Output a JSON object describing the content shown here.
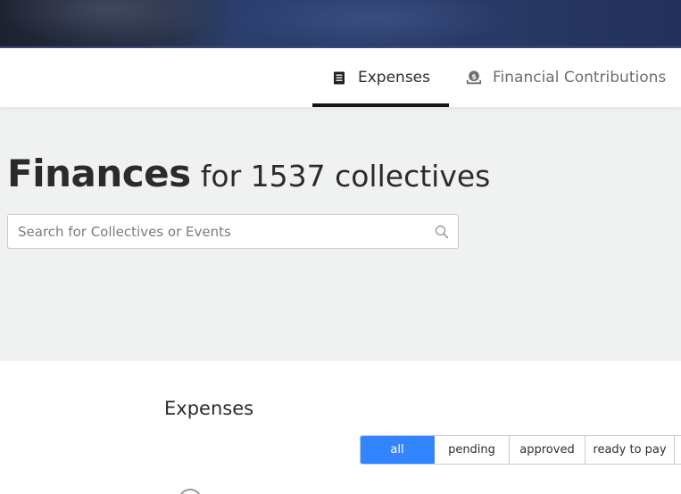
{
  "tabs": {
    "expenses": {
      "label": "Expenses",
      "icon": "receipt-icon",
      "active": true
    },
    "contributions": {
      "label": "Financial Contributions",
      "icon": "money-upload-icon",
      "active": false
    }
  },
  "hero": {
    "title_strong": "Finances",
    "title_rest": "for 1537 collectives",
    "search": {
      "placeholder": "Search for Collectives or Events",
      "value": "",
      "icon": "search-icon"
    }
  },
  "expenses": {
    "heading": "Expenses",
    "filters": [
      "all",
      "pending",
      "approved",
      "ready to pay"
    ],
    "active_filter": "all"
  },
  "colors": {
    "accent": "#3385ff",
    "banner": "#2c3f6f",
    "hero_bg": "#f0f1f1",
    "tab_underline": "#141414"
  }
}
